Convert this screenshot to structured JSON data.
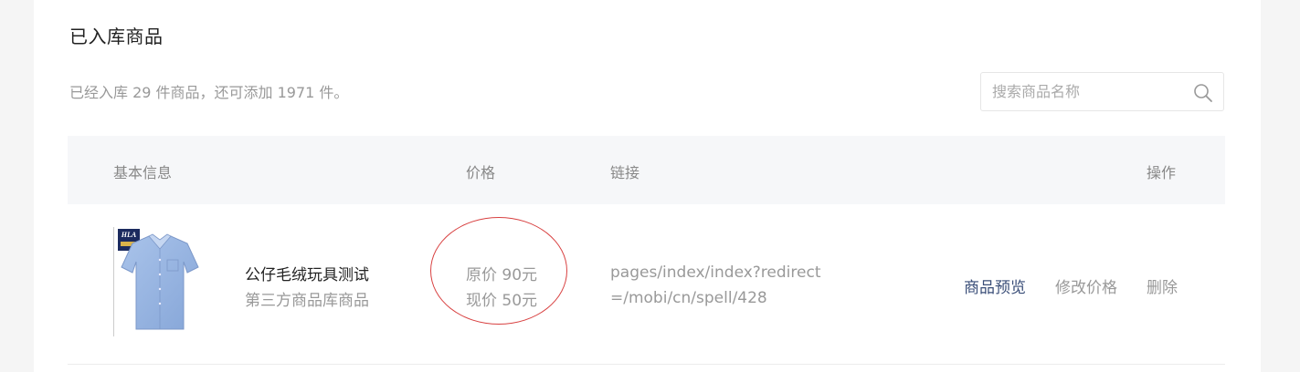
{
  "section": {
    "title": "已入库商品",
    "summary": "已经入库 29 件商品，还可添加 1971 件。"
  },
  "search": {
    "placeholder": "搜索商品名称",
    "value": ""
  },
  "table": {
    "columns": [
      "基本信息",
      "价格",
      "链接",
      "操作"
    ],
    "rows": [
      {
        "image_brand": "HLA",
        "name": "公仔毛绒玩具测试",
        "source": "第三方商品库商品",
        "original_price": "原价 90元",
        "current_price": "现价 50元",
        "link": "pages/index/index?redirect=/mobi/cn/spell/428",
        "actions": [
          "商品预览",
          "修改价格",
          "删除"
        ]
      }
    ]
  },
  "colors": {
    "action_primary": "#3a4e78",
    "annotation_circle": "#d84040",
    "header_bg": "#f6f7f9"
  }
}
